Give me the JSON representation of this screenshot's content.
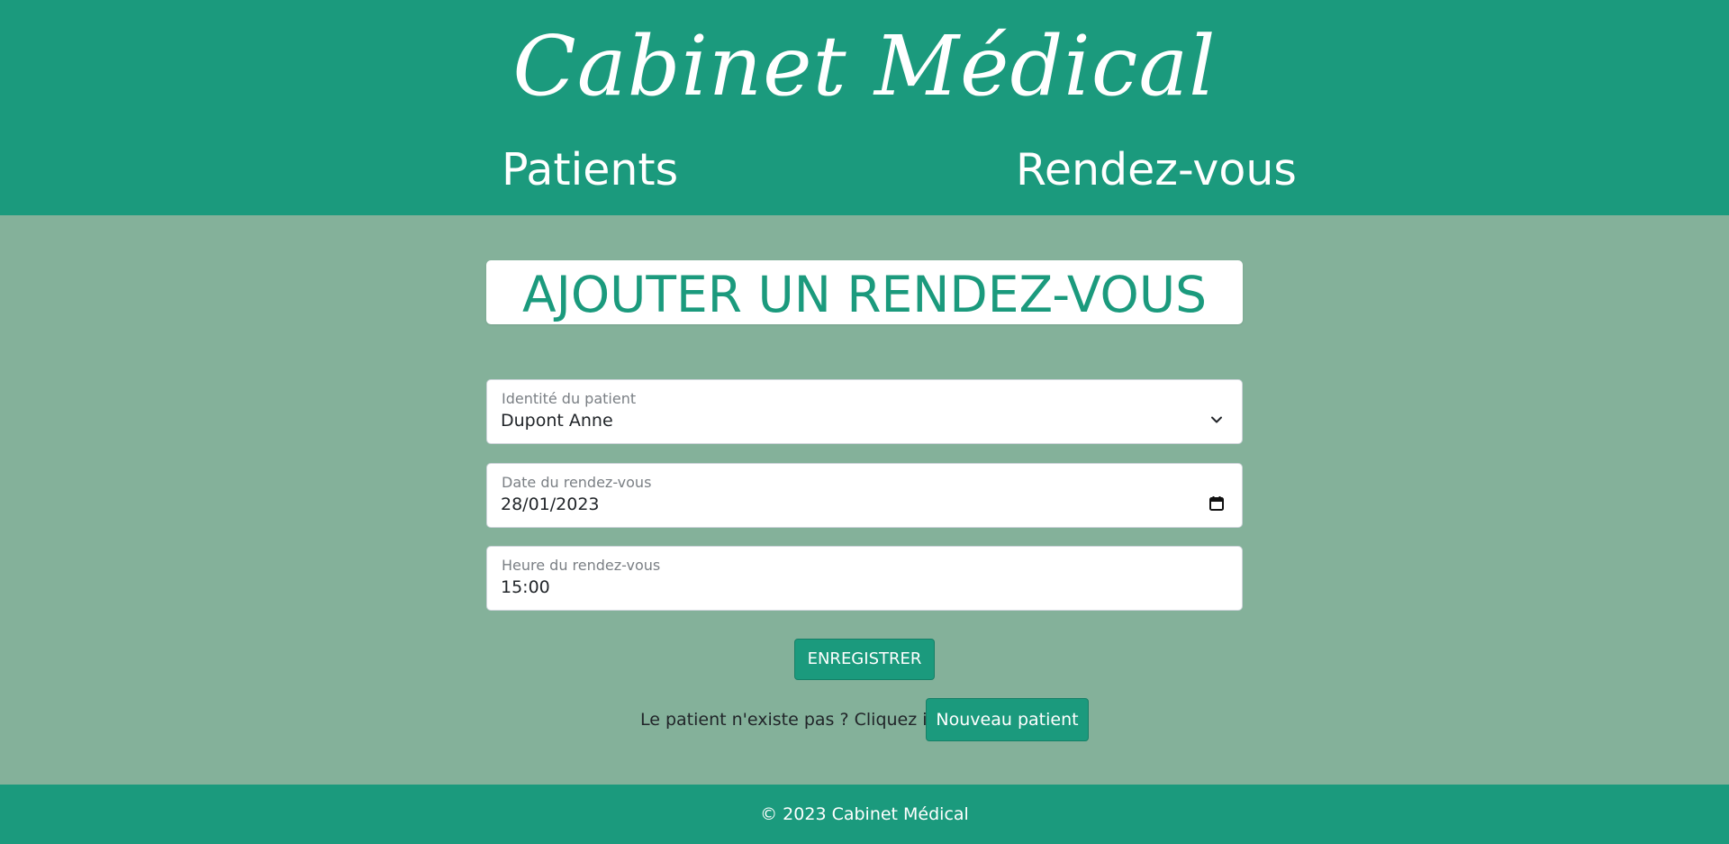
{
  "header": {
    "site_title": "Cabinet Médical",
    "nav": [
      {
        "label": "Patients"
      },
      {
        "label": "Rendez-vous"
      }
    ]
  },
  "main": {
    "heading": "AJOUTER UN RENDEZ-VOUS",
    "form": {
      "patient": {
        "label": "Identité du patient",
        "value": "Dupont Anne",
        "icon": "chevron-down-icon"
      },
      "date": {
        "label": "Date du rendez-vous",
        "value": "28/01/2023",
        "icon": "calendar-icon"
      },
      "time": {
        "label": "Heure du rendez-vous",
        "value": "15:00"
      },
      "submit_label": "ENREGISTRER"
    },
    "new_patient": {
      "prompt": "Le patient n'existe pas ? Cliquez ici :",
      "button_label": "Nouveau patient"
    }
  },
  "footer": {
    "text": "© 2023 Cabinet Médical"
  },
  "colors": {
    "brand": "#1b9a7d",
    "background": "#84b19a",
    "surface": "#ffffff"
  }
}
